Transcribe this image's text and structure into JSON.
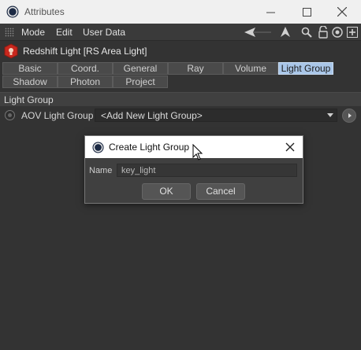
{
  "window": {
    "title": "Attributes",
    "controls": [
      "minimize-icon",
      "maximize-icon",
      "close-icon"
    ]
  },
  "menubar": {
    "items": [
      "Mode",
      "Edit",
      "User Data"
    ],
    "tools": [
      "back-arrow-icon",
      "up-arrow-icon",
      "search-icon",
      "lock-icon",
      "target-icon",
      "add-panel-icon"
    ]
  },
  "object": {
    "name": "Redshift Light [RS Area Light]",
    "icon": "redshift-light-icon"
  },
  "tabs": {
    "row1": [
      "Basic",
      "Coord.",
      "General",
      "Ray",
      "Volume",
      "Light Group"
    ],
    "row2": [
      "Shadow",
      "Photon",
      "Project"
    ],
    "active": "Light Group"
  },
  "section": {
    "title": "Light Group"
  },
  "aov": {
    "label": "AOV Light Group",
    "value": "<Add New Light Group>"
  },
  "dialog": {
    "title": "Create Light Group",
    "name_label": "Name",
    "name_value": "key_light",
    "ok_label": "OK",
    "cancel_label": "Cancel"
  },
  "colors": {
    "background": "#333333",
    "active_tab": "#a9c6e8",
    "title_bar": "#f0f0f0"
  }
}
